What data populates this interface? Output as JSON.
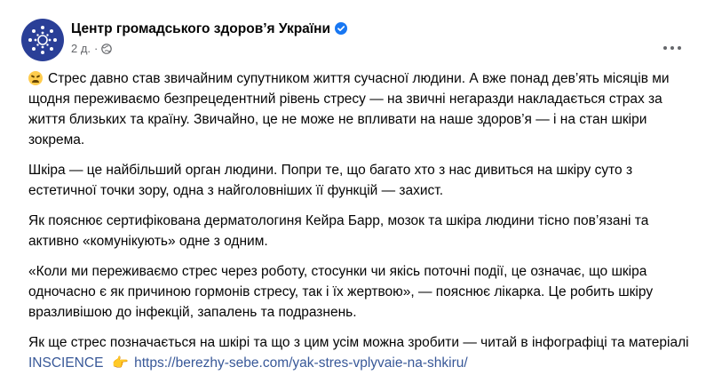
{
  "header": {
    "page_name": "Центр громадського здоров’я України",
    "time": "2 д.",
    "dot": "·",
    "more_icon": "more-horizontal-icon",
    "verified_icon": "verified-badge-icon",
    "audience_icon": "globe-icon"
  },
  "post": {
    "p1": "Стрес давно став звичайним супутником життя сучасної людини. А вже понад дев’ять місяців ми щодня переживаємо безпрецедентний рівень стресу — на звичні негаразди накладається страх за життя близьких та країну. Звичайно, це не може не впливати на наше здоров’я — і на стан шкіри зокрема.",
    "p2": "Шкіра — це найбільший орган людини. Попри те, що багато хто з нас дивиться на шкіру суто з естетичної точки зору, одна з найголовніших її функцій — захист.",
    "p3": "Як пояснює сертифікована дерматологиня Кейра Барр, мозок та шкіра людини тісно пов’язані та активно «комунікують» одне з одним.",
    "p4": "«Коли ми переживаємо стрес через роботу, стосунки чи якісь поточні події, це означає, що шкіра одночасно є як причиною гормонів стресу, так і їх жертвою», — пояснює лікарка. Це робить шкіру вразливішою до інфекцій, запалень та подразнень.",
    "p5_text": "Як ще стрес позначається на шкірі та що з цим усім можна зробити — читай в інфографіці та матеріалі ",
    "p5_link_name": "INSCIENCE",
    "p5_emoji": "👉",
    "p5_url": "https://berezhy-sebe.com/yak-stres-vplyvaie-na-shkiru/"
  },
  "colors": {
    "avatar_bg": "#2a3f97",
    "link": "#385898",
    "verified": "#1877f2",
    "meta": "#65676b"
  }
}
